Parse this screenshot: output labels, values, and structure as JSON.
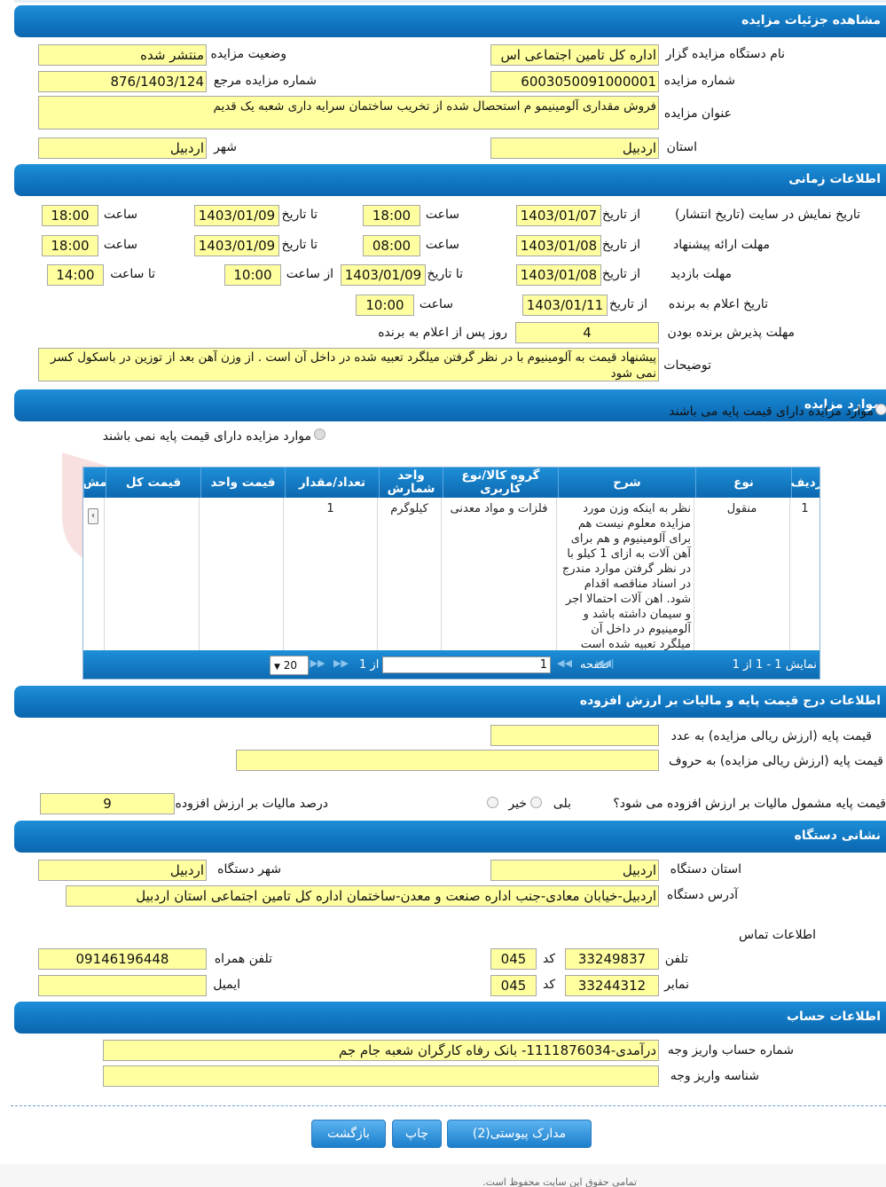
{
  "sections": {
    "details": "مشاهده جزئیات مزایده",
    "time": "اطلاعات زمانی",
    "items": "موارد مزایده",
    "price": "اطلاعات درج قیمت پایه و مالیات بر ارزش افزوده",
    "address": "نشانی دستگاه",
    "account": "اطلاعات حساب"
  },
  "details": {
    "org_label": "نام دستگاه مزایده گزار",
    "org_value": "اداره کل تامین اجتماعی اس",
    "status_label": "وضعیت مزایده",
    "status_value": "منتشر شده",
    "number_label": "شماره مزایده",
    "number_value": "6003050091000001",
    "ref_label": "شماره مزایده مرجع",
    "ref_value": "876/1403/124",
    "title_label": "عنوان مزایده",
    "title_value": "فروش مقداری آلومینیمو م استحصال شده از تخریب ساختمان سرایه داری شعبه یک قدیم",
    "province_label": "استان",
    "province_value": "اردبیل",
    "city_label": "شهر",
    "city_value": "اردبیل"
  },
  "time": {
    "display_label": "تاریخ نمایش در سایت (تاریخ انتشار)",
    "offer_label": "مهلت ارائه پیشنهاد",
    "visit_label": "مهلت بازدید",
    "announce_label": "تاریخ اعلام به برنده",
    "accept_label": "مهلت پذیرش برنده بودن",
    "notes_label": "توضیحات",
    "from_date": "از تاریخ",
    "to_date": "تا تاریخ",
    "hour": "ساعت",
    "from_hour": "از ساعت",
    "to_hour": "تا ساعت",
    "display_from": "1403/01/07",
    "display_from_time": "18:00",
    "display_to": "1403/01/09",
    "display_to_time": "18:00",
    "offer_from": "1403/01/08",
    "offer_from_time": "08:00",
    "offer_to": "1403/01/09",
    "offer_to_time": "18:00",
    "visit_from": "1403/01/08",
    "visit_to": "1403/01/09",
    "visit_from_time": "10:00",
    "visit_to_time": "14:00",
    "announce_date": "1403/01/11",
    "announce_time": "10:00",
    "accept_days": "4",
    "accept_suffix": "روز پس از اعلام به برنده",
    "notes": "پیشنهاد قیمت به آلومینیوم با در نظر گرفتن میلگرد تعبیه شده در داخل آن است . از وزن آهن بعد از توزین در باسکول کسر نمی شود"
  },
  "items": {
    "has_base": "موارد مزایده دارای قیمت پایه می باشند",
    "no_base": "موارد مزایده دارای قیمت پایه نمی باشند",
    "headers": [
      "ردیف",
      "نوع",
      "شرح",
      "گروه کالا/نوع کاربری",
      "واحد شمارش",
      "تعداد/مقدار",
      "قیمت واحد",
      "قیمت کل",
      "مش"
    ],
    "row": {
      "idx": "1",
      "type": "منقول",
      "desc": "نظر به اینکه وزن مورد مزایده معلوم نیست هم برای آلومینیوم و هم برای آهن آلات به ازای 1 کیلو با در نظر گرفتن موارد مندرج در اسناد مناقصه اقدام شود. اهن آلات احتمالا اجر و سیمان داشته باشد و آلومینیوم در داخل آن میلگرد تعبیه شده است",
      "group": "فلزات و مواد معدنی",
      "unit": "کیلوگرم",
      "qty": "1",
      "unit_price": "",
      "total": ""
    },
    "footer": {
      "show": "نمایش 1 - 1 از 1",
      "page": "صفحه",
      "page_value": "1",
      "of": "از 1",
      "size": "20"
    }
  },
  "price": {
    "num_label": "قیمت پایه (ارزش ریالی مزایده) به عدد",
    "num_value": "",
    "word_label": "قیمت پایه (ارزش ریالی مزایده) به حروف",
    "word_value": "",
    "vat_q": "قیمت پایه مشمول مالیات بر ارزش افزوده می شود؟",
    "yes": "بلی",
    "no": "خیر",
    "vat_label": "درصد مالیات بر ارزش افزوده",
    "vat_value": "9"
  },
  "address": {
    "province_label": "استان دستگاه",
    "province_value": "اردبیل",
    "city_label": "شهر دستگاه",
    "city_value": "اردبیل",
    "addr_label": "آدرس دستگاه",
    "addr_value": "اردبیل-خیابان معادی-جنب اداره صنعت و معدن-ساختمان اداره کل تامین اجتماعی استان اردبیل",
    "contact_label": "اطلاعات تماس",
    "phone_label": "تلفن",
    "phone_value": "33249837",
    "code_label": "کد",
    "phone_code": "045",
    "mobile_label": "تلفن همراه",
    "mobile_value": "09146196448",
    "fax_label": "نمابر",
    "fax_value": "33244312",
    "fax_code": "045",
    "email_label": "ایمیل",
    "email_value": ""
  },
  "account": {
    "acc_label": "شماره حساب واریز وجه",
    "acc_value": "درآمدی-1111876034- بانک رفاه کارگران شعبه جام جم",
    "id_label": "شناسه واریز وجه",
    "id_value": ""
  },
  "buttons": {
    "attachments": "مدارک پیوستی(2)",
    "print": "چاپ",
    "back": "بازگشت"
  },
  "footer_text": "تمامی حقوق این سایت محفوظ است.",
  "colors": {
    "header": "#1177c2",
    "field": "#ffffa0"
  }
}
